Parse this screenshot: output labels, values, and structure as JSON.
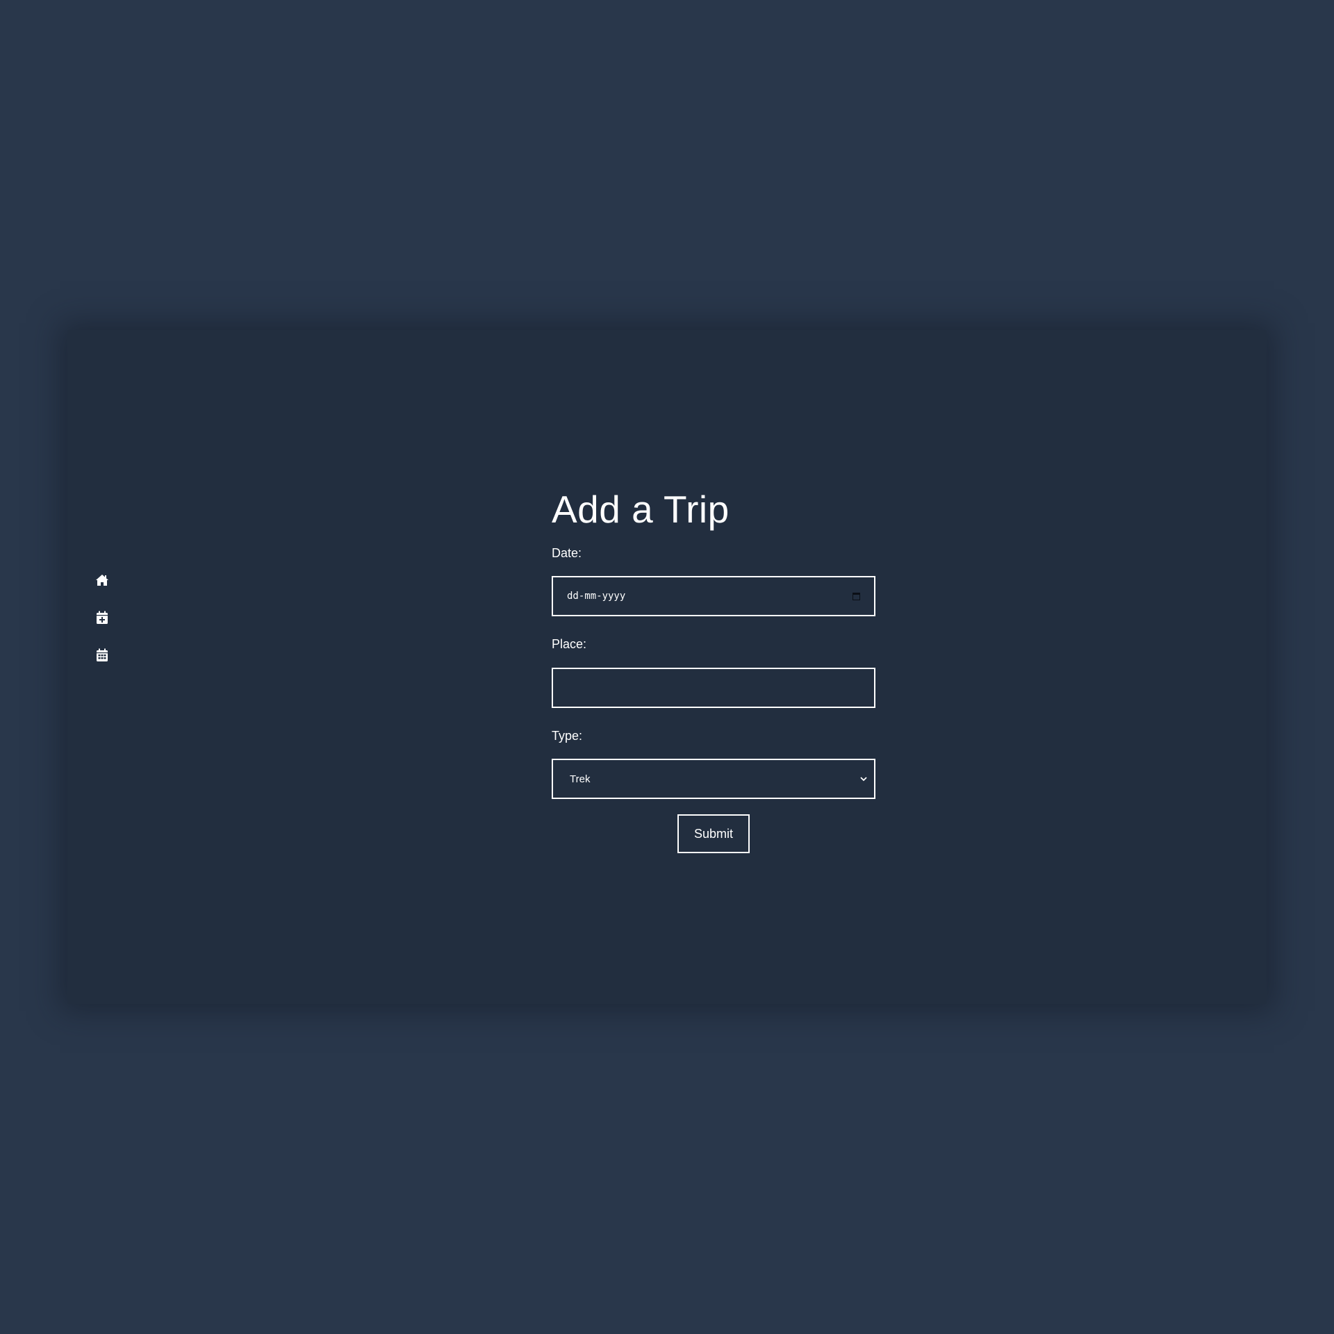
{
  "nav": {
    "items": [
      {
        "icon": "home-icon"
      },
      {
        "icon": "calendar-plus-icon"
      },
      {
        "icon": "calendar-icon"
      }
    ]
  },
  "form": {
    "title": "Add a Trip",
    "date": {
      "label": "Date:",
      "placeholder": "dd-mm-yyyy"
    },
    "place": {
      "label": "Place:",
      "value": ""
    },
    "type": {
      "label": "Type:",
      "selected": "Trek"
    },
    "submit_label": "Submit"
  },
  "colors": {
    "page_background": "#29374b",
    "panel_background": "#222e3f",
    "foreground": "#ffffff"
  }
}
